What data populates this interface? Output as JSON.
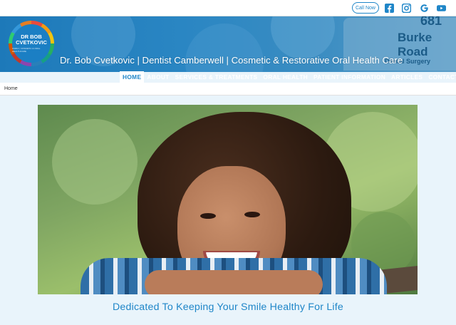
{
  "topbar": {
    "call_label": "Call Now",
    "social": [
      {
        "icon": "facebook-icon"
      },
      {
        "icon": "instagram-icon"
      },
      {
        "icon": "google-icon"
      },
      {
        "icon": "youtube-icon"
      }
    ]
  },
  "header": {
    "logo": {
      "line1": "DR BOB",
      "line2": "CVETKOVIC",
      "line3": "FAMILY, COSMETIC & ORAL HEALTHCARE"
    },
    "site_title": "Dr. Bob Cvetkovic | Dentist Camberwell | Cosmetic & Restorative Oral Health Care",
    "sign": {
      "number": "681",
      "street": "Burke Road",
      "label": "Dental Surgery"
    }
  },
  "nav": {
    "items": [
      {
        "label": "HOME",
        "active": true
      },
      {
        "label": "ABOUT",
        "active": false
      },
      {
        "label": "SERVICES & TREATMENTS",
        "active": false
      },
      {
        "label": "ORAL HEALTH",
        "active": false
      },
      {
        "label": "PATIENT INFORMATION",
        "active": false
      },
      {
        "label": "ARTICLES",
        "active": false
      },
      {
        "label": "CONTACT",
        "active": false
      }
    ]
  },
  "breadcrumb": {
    "home": "Home"
  },
  "hero": {
    "image": "smiling-girl-photo"
  },
  "tagline": "Dedicated To Keeping Your Smile Healthy For Life",
  "colors": {
    "accent": "#1f86c8",
    "header": "#1d79b9",
    "background": "#e9f4fb"
  }
}
